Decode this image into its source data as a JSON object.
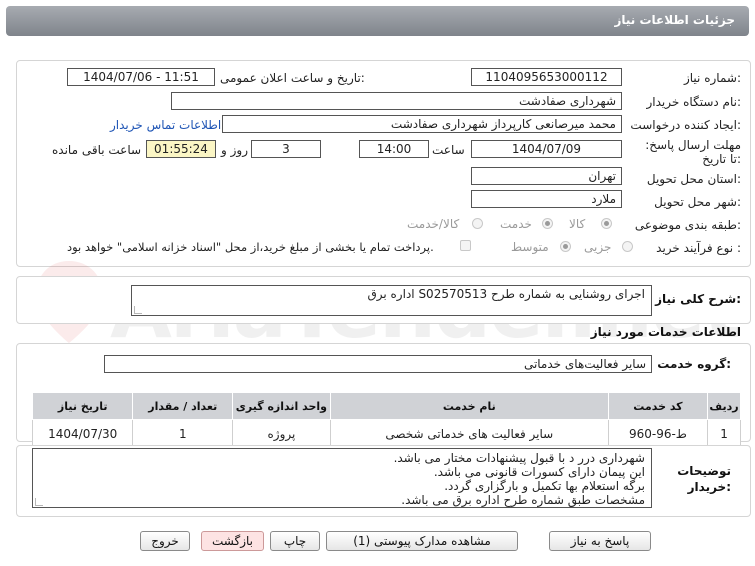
{
  "window_title": "جزئیات اطلاعات نیاز",
  "fields": {
    "need_number_label": "شماره نیاز:",
    "need_number": "1104095653000112",
    "announce_label": "تاریخ و ساعت اعلان عمومی:",
    "announce_value": "1404/07/06 - 11:51",
    "buyer_label": "نام دستگاه خریدار:",
    "buyer_value": "شهرداری صفادشت",
    "creator_label": "ایجاد کننده درخواست:",
    "creator_value": "محمد میرصانعی کارپرداز شهرداری صفادشت",
    "contact_link": "اطلاعات تماس خریدار",
    "deadline_label": "مهلت ارسال پاسخ: تا تاریخ:",
    "deadline_date": "1404/07/09",
    "time_label": "ساعت",
    "deadline_time": "14:00",
    "days_value": "3",
    "days_label": "روز و",
    "remaining_value": "01:55:24",
    "remaining_label": "ساعت باقی مانده",
    "province_label": "استان محل تحویل:",
    "province_value": "تهران",
    "city_label": "شهر محل تحویل:",
    "city_value": "ملارد",
    "category_label": "طبقه بندی موضوعی:",
    "category_opt1": "کالا",
    "category_opt2": "خدمت",
    "category_opt3": "کالا/خدمت",
    "process_label": "نوع فرآیند خرید :",
    "process_opt1": "جزیی",
    "process_opt2": "متوسط",
    "payment_note": "پرداخت تمام یا بخشی از مبلغ خرید،از محل \"اسناد خزانه اسلامی\" خواهد بود."
  },
  "description": {
    "label": "شرح کلی نیاز:",
    "value": "اجرای روشنایی به شماره طرح S02570513 اداره برق"
  },
  "services": {
    "section_title": "اطلاعات خدمات مورد نیاز",
    "group_label": "گروه خدمت:",
    "group_value": "سایر فعالیت‌های خدماتی",
    "columns": [
      "ردیف",
      "کد خدمت",
      "نام خدمت",
      "واحد اندازه گیری",
      "تعداد / مقدار",
      "تاریخ نیاز"
    ],
    "rows": [
      [
        "1",
        "ط-96-960",
        "سایر فعالیت های خدماتی شخصی",
        "پروژه",
        "1",
        "1404/07/30"
      ]
    ]
  },
  "buyer_notes": {
    "label": "توضیحات خریدار:",
    "lines": [
      "شهرداری درر د با قبول پیشنهادات مختار می باشد.",
      "این پیمان دارای کسورات قانونی می باشد.",
      "برگه استعلام بها تکمیل و بارگزاری گردد.",
      "مشخصات طبق شماره طرح اداره برق می باشد."
    ]
  },
  "buttons": {
    "reply": "پاسخ به نیاز",
    "docs": "مشاهده مدارک پیوستی (1)",
    "print": "چاپ",
    "back": "بازگشت",
    "exit": "خروج"
  },
  "watermark": "AriaTender.net",
  "colors": {
    "title_bar": "#8f949a",
    "yellow_field": "#fbf6c5",
    "link": "#1f55b5",
    "table_header": "#d0d2d6"
  }
}
